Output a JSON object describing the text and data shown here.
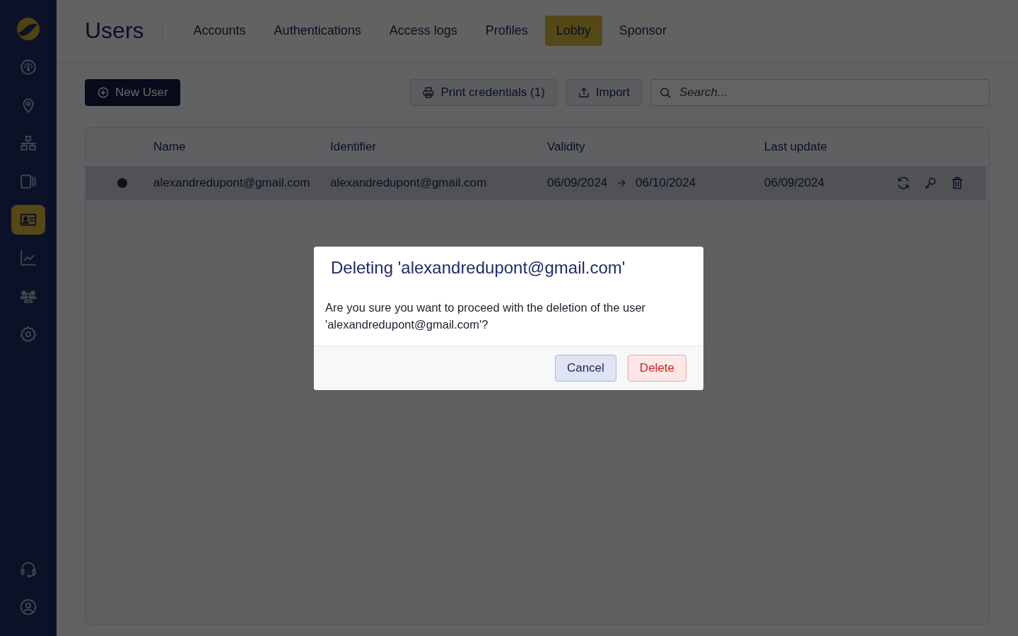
{
  "sidebar": {
    "items": [
      {
        "kind": "gauge",
        "selected": false
      },
      {
        "kind": "pin",
        "selected": false
      },
      {
        "kind": "network",
        "selected": false
      },
      {
        "kind": "devices",
        "selected": false
      },
      {
        "kind": "idcard",
        "selected": true
      },
      {
        "kind": "chart",
        "selected": false
      },
      {
        "kind": "group",
        "selected": false
      },
      {
        "kind": "gear",
        "selected": false
      }
    ],
    "bottom_items": [
      {
        "kind": "headset",
        "selected": false
      },
      {
        "kind": "user",
        "selected": false
      }
    ]
  },
  "header": {
    "title": "Users",
    "tabs": [
      {
        "label": "Accounts",
        "selected": false
      },
      {
        "label": "Authentications",
        "selected": false
      },
      {
        "label": "Access logs",
        "selected": false
      },
      {
        "label": "Profiles",
        "selected": false
      },
      {
        "label": "Lobby",
        "selected": true
      },
      {
        "label": "Sponsor",
        "selected": false
      }
    ]
  },
  "toolbar": {
    "new_user": "New User",
    "print": "Print credentials (1)",
    "import": "Import",
    "search": {
      "placeholder": "Search..."
    }
  },
  "table": {
    "columns": [
      "Name",
      "Identifier",
      "Validity",
      "Last update"
    ],
    "rows": [
      {
        "selected": true,
        "color": "#2a2b30",
        "name": "alexandredupont@gmail.com",
        "identifier": "alexandredupont@gmail.com",
        "valid_from": "06/09/2024",
        "valid_to": "06/10/2024",
        "last_update": "06/09/2024"
      }
    ]
  },
  "dialog": {
    "title": "Deleting 'alexandredupont@gmail.com'",
    "message": "Are you sure you want to proceed with the deletion of the user 'alexandredupont@gmail.com'?",
    "buttons": [
      {
        "label": "Cancel",
        "kind": "secondary"
      },
      {
        "label": "Delete",
        "kind": "danger"
      }
    ]
  }
}
